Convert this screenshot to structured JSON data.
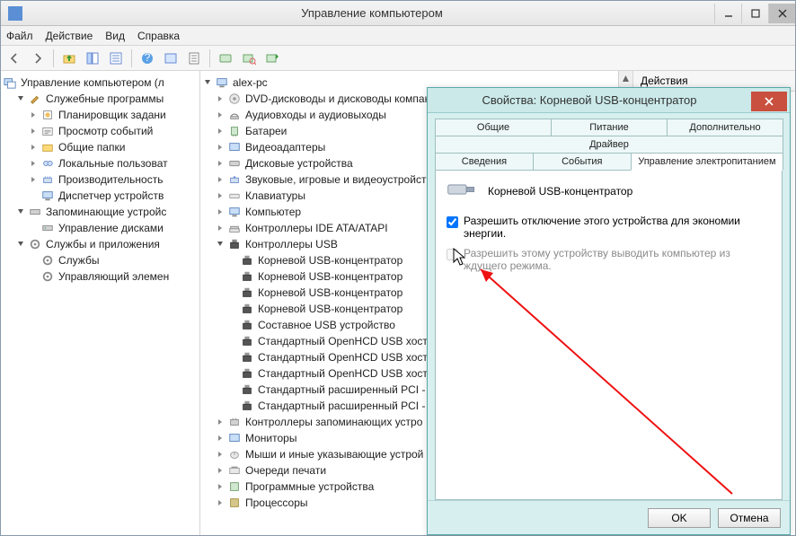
{
  "window": {
    "title": "Управление компьютером"
  },
  "menu": {
    "file": "Файл",
    "action": "Действие",
    "view": "Вид",
    "help": "Справка"
  },
  "left_tree": {
    "root": "Управление компьютером (л",
    "g1": "Служебные программы",
    "g1_items": [
      "Планировщик задани",
      "Просмотр событий",
      "Общие папки",
      "Локальные пользоват",
      "Производительность",
      "Диспетчер устройств"
    ],
    "g2": "Запоминающие устройс",
    "g2_items": [
      "Управление дисками"
    ],
    "g3": "Службы и приложения",
    "g3_items": [
      "Службы",
      "Управляющий элемен"
    ]
  },
  "mid_tree": {
    "root": "alex-pc",
    "cats": [
      {
        "l": "DVD-дисководы и дисководы компак",
        "exp": true
      },
      {
        "l": "Аудиовходы и аудиовыходы",
        "exp": true
      },
      {
        "l": "Батареи",
        "exp": true
      },
      {
        "l": "Видеоадаптеры",
        "exp": true
      },
      {
        "l": "Дисковые устройства",
        "exp": true
      },
      {
        "l": "Звуковые, игровые и видеоустройст",
        "exp": true
      },
      {
        "l": "Клавиатуры",
        "exp": true
      },
      {
        "l": "Компьютер",
        "exp": true
      },
      {
        "l": "Контроллеры IDE ATA/ATAPI",
        "exp": true
      },
      {
        "l": "Контроллеры USB",
        "exp": false,
        "open": true
      },
      {
        "l": "Контроллеры запоминающих устро",
        "exp": true
      },
      {
        "l": "Мониторы",
        "exp": true
      },
      {
        "l": "Мыши и иные указывающие устрой",
        "exp": true
      },
      {
        "l": "Очереди печати",
        "exp": true
      },
      {
        "l": "Программные устройства",
        "exp": true
      },
      {
        "l": "Процессоры",
        "exp": true
      }
    ],
    "usb_children": [
      "Корневой USB-концентратор",
      "Корневой USB-концентратор",
      "Корневой USB-концентратор",
      "Корневой USB-концентратор",
      "Составное USB устройство",
      "Стандартный OpenHCD USB хост-",
      "Стандартный OpenHCD USB хост-",
      "Стандартный OpenHCD USB хост-",
      "Стандартный расширенный PCI -",
      "Стандартный расширенный PCI -"
    ]
  },
  "right_pane": {
    "header": "Действия"
  },
  "dialog": {
    "title": "Свойства: Корневой USB-концентратор",
    "tabs": {
      "general": "Общие",
      "power": "Питание",
      "advanced": "Дополнительно",
      "driver": "Драйвер",
      "details": "Сведения",
      "events": "События",
      "power_mgmt": "Управление электропитанием"
    },
    "device_name": "Корневой USB-концентратор",
    "cb1": "Разрешить отключение этого устройства для экономии энергии.",
    "cb2": "Разрешить этому устройству выводить компьютер из ждущего режима.",
    "ok": "OK",
    "cancel": "Отмена"
  }
}
